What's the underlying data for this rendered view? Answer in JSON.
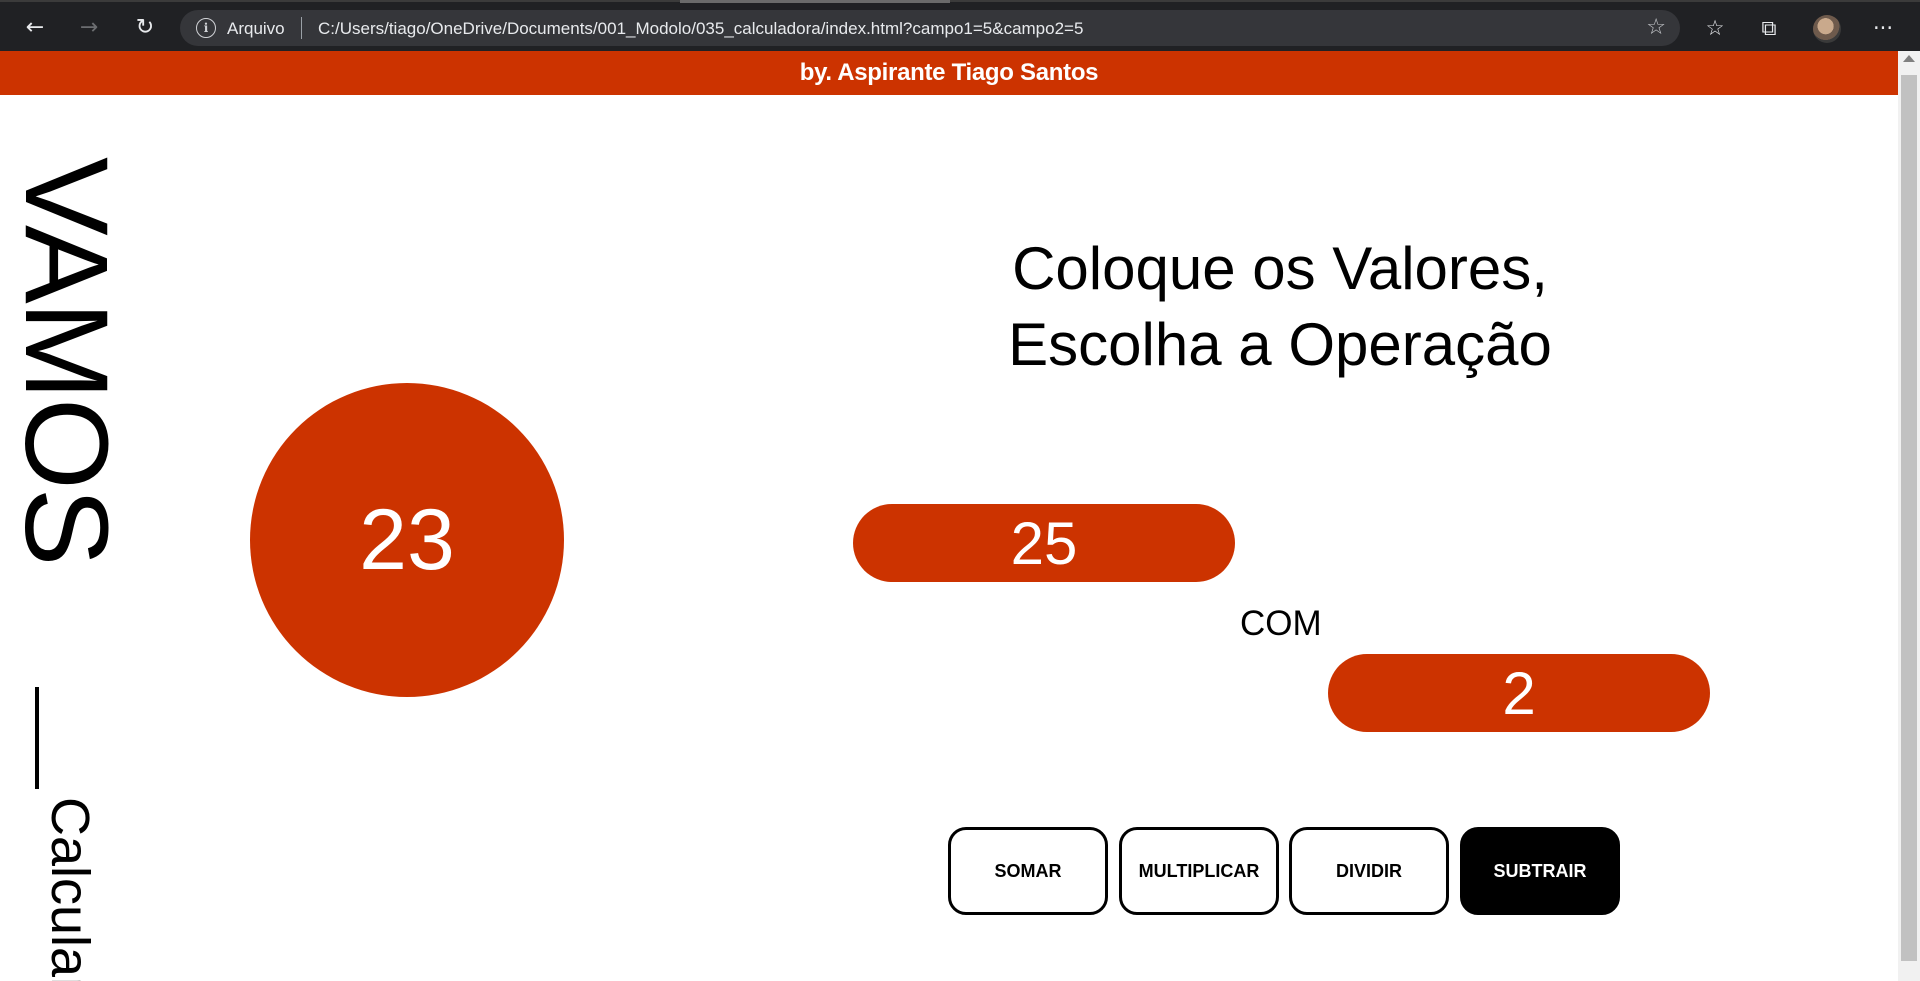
{
  "browser": {
    "back_icon": "←",
    "forward_icon": "→",
    "reload_icon": "↻",
    "security_label": "Arquivo",
    "url": "C:/Users/tiago/OneDrive/Documents/001_Modolo/035_calculadora/index.html?campo1=5&campo2=5",
    "favorite_icon": "☆",
    "favorites_icon": "☆",
    "collections_icon": "⧉",
    "menu_icon": "···"
  },
  "banner": {
    "text": "by. Aspirante Tiago Santos"
  },
  "side": {
    "title": "VAMOS",
    "subtitle": "Calcular"
  },
  "result": {
    "value": "23"
  },
  "heading": {
    "line1": "Coloque os Valores,",
    "line2": "Escolha a Operação"
  },
  "inputs": {
    "campo1": "25",
    "campo2": "2",
    "connector": "COM"
  },
  "operations": [
    {
      "label": "SOMAR"
    },
    {
      "label": "MULTIPLICAR"
    },
    {
      "label": "DIVIDIR"
    },
    {
      "label": "SUBTRAIR"
    }
  ],
  "colors": {
    "accent": "#cc3300",
    "dark": "#000000",
    "chrome": "#202124"
  }
}
